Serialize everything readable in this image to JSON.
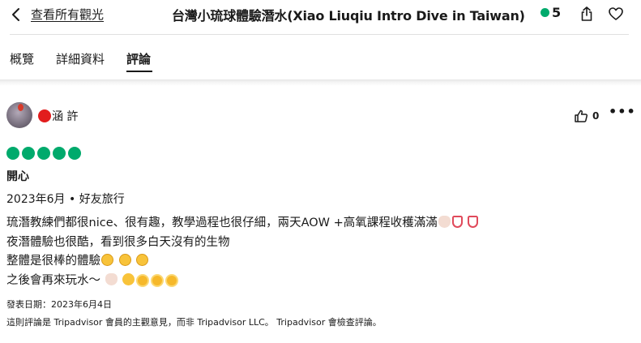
{
  "header": {
    "back_label": "查看所有觀光",
    "title": "台灣小琉球體驗潛水(Xiao Liuqiu Intro Dive in Taiwan)",
    "rating": "5"
  },
  "tabs": [
    {
      "label": "概覽"
    },
    {
      "label": "詳細資料"
    },
    {
      "label": "評論"
    }
  ],
  "review": {
    "user_name": "涵 許",
    "helpful_count": "0",
    "rating_bubbles": 5,
    "title": "開心",
    "meta": "2023年6月 • 好友旅行",
    "lines": [
      "琉潛教練們都很nice、很有趣，教學過程也很仔細，兩天AOW +高氧課程收穫滿滿",
      "夜潛體驗也很酷，看到很多白天沒有的生物",
      "整體是很棒的體驗",
      "之後會再來玩水～"
    ],
    "date_written": "發表日期：2023年6月4日",
    "disclaimer": "這則評論是 Tripadvisor 會員的主觀意見，而非 Tripadvisor LLC。 Tripadvisor 會檢查評論。"
  },
  "colors": {
    "accent_green": "#00aa6c",
    "text": "#1a1a1a"
  },
  "icons": [
    "chevron-left-icon",
    "share-icon",
    "heart-icon",
    "thumbs-up-icon",
    "more-icon"
  ]
}
